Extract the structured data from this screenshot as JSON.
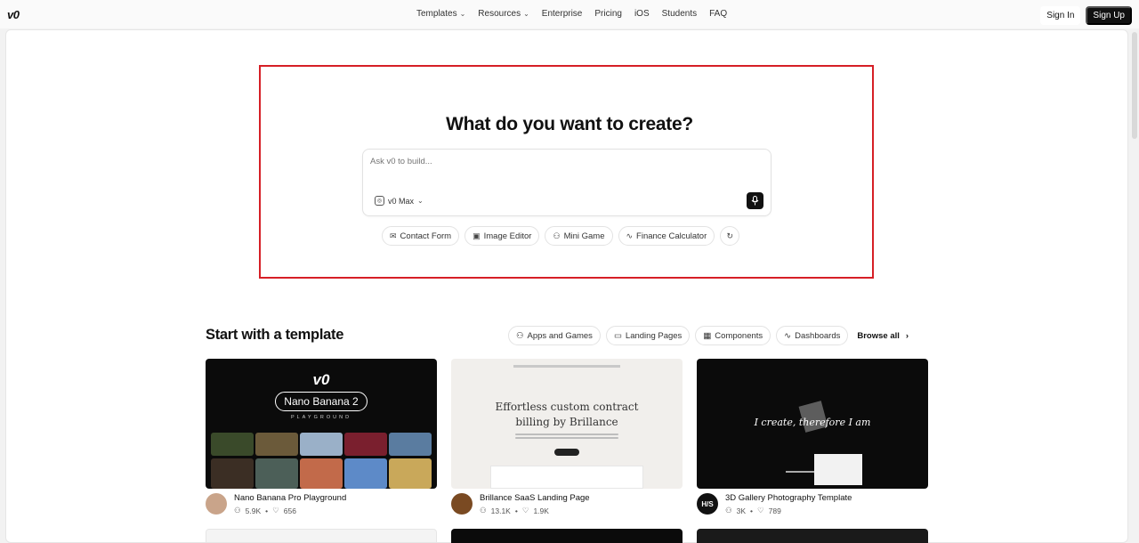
{
  "nav": {
    "logo": "v0",
    "links": [
      {
        "label": "Templates",
        "dropdown": true
      },
      {
        "label": "Resources",
        "dropdown": true
      },
      {
        "label": "Enterprise",
        "dropdown": false
      },
      {
        "label": "Pricing",
        "dropdown": false
      },
      {
        "label": "iOS",
        "dropdown": false
      },
      {
        "label": "Students",
        "dropdown": false
      },
      {
        "label": "FAQ",
        "dropdown": false
      }
    ],
    "sign_in": "Sign In",
    "sign_up": "Sign Up"
  },
  "hero": {
    "title": "What do you want to create?",
    "prompt_placeholder": "Ask v0 to build...",
    "model": "v0 Max",
    "suggestions": [
      {
        "label": "Contact Form",
        "icon": "mail-icon"
      },
      {
        "label": "Image Editor",
        "icon": "image-icon"
      },
      {
        "label": "Mini Game",
        "icon": "game-icon"
      },
      {
        "label": "Finance Calculator",
        "icon": "chart-line-icon"
      }
    ]
  },
  "templates": {
    "title": "Start with a template",
    "filters": [
      {
        "label": "Apps and Games",
        "icon": "apps-icon"
      },
      {
        "label": "Landing Pages",
        "icon": "layout-icon"
      },
      {
        "label": "Components",
        "icon": "grid-icon"
      },
      {
        "label": "Dashboards",
        "icon": "pulse-icon"
      }
    ],
    "browse_all": "Browse all",
    "cards": [
      {
        "title": "Nano Banana Pro Playground",
        "users": "5.9K",
        "likes": "656",
        "thumb": {
          "logo": "v0",
          "badge": "Nano Banana 2",
          "caption": "PLAYGROUND"
        }
      },
      {
        "title": "Brillance SaaS Landing Page",
        "users": "13.1K",
        "likes": "1.9K",
        "thumb": {
          "headline": "Effortless custom contract billing by Brillance"
        }
      },
      {
        "title": "3D Gallery Photography Template",
        "users": "3K",
        "likes": "789",
        "thumb": {
          "headline": "I create, therefore I am"
        },
        "avatar_text": "H/S"
      }
    ]
  },
  "colors": {
    "highlight": "#d61f26",
    "dark": "#111111"
  }
}
